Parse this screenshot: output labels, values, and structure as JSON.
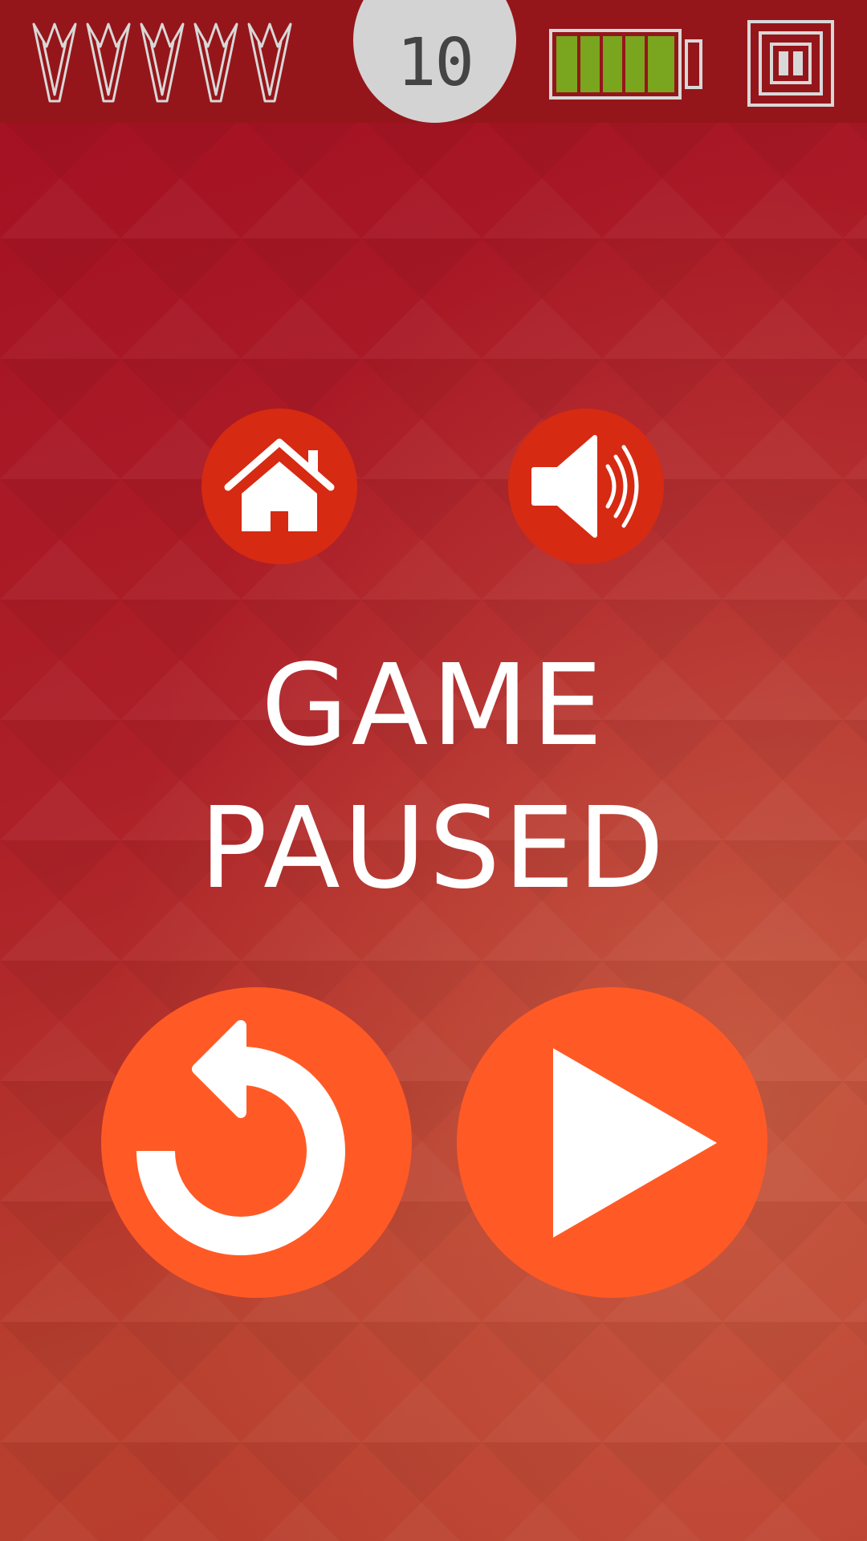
{
  "hud": {
    "lives_count": 5,
    "lives_icon": "dart-icon",
    "score": "10",
    "battery_level": 1.0,
    "battery_color": "#7aa51f",
    "pause_icon": "pause-icon"
  },
  "pause_menu": {
    "title_line1": "GAME",
    "title_line2": "PAUSED",
    "home_icon": "home-icon",
    "sound_icon": "speaker-on-icon",
    "restart_icon": "restart-icon",
    "play_icon": "play-icon"
  },
  "colors": {
    "topbar": "#95161a",
    "small_button": "#d62a12",
    "large_button": "#ff5a25",
    "score_bubble": "#d4d3d3"
  }
}
